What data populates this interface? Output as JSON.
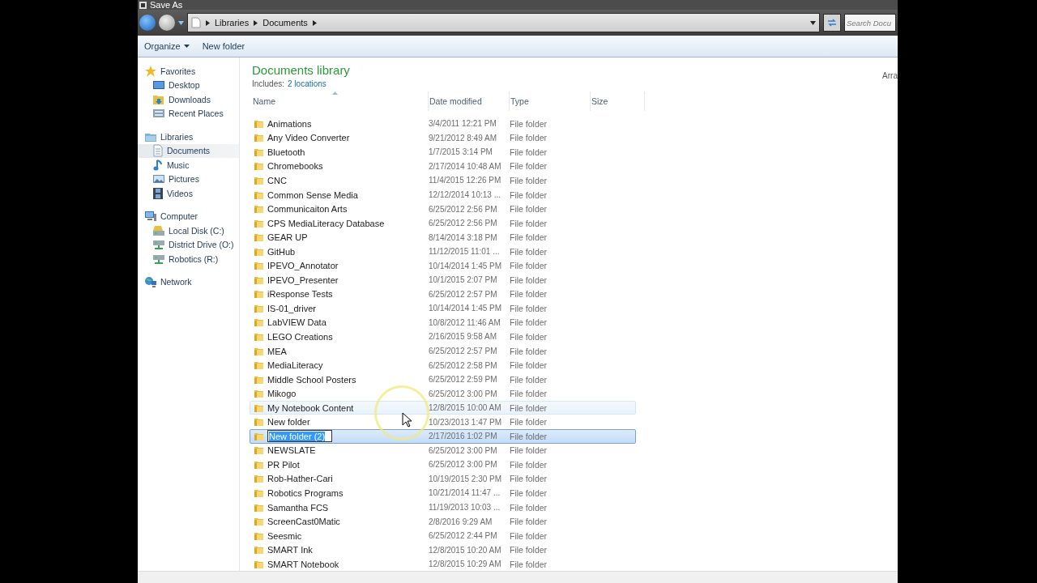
{
  "window": {
    "title": "Save As"
  },
  "address_bar": {
    "breadcrumbs": [
      "Libraries",
      "Documents"
    ]
  },
  "search": {
    "placeholder": "Search Docu"
  },
  "toolbar": {
    "buttons": [
      {
        "label": "Organize",
        "kind": "menu"
      },
      {
        "label": "New folder",
        "kind": "button"
      }
    ]
  },
  "navigation": {
    "sections": [
      {
        "label": "Favorites",
        "selected": false,
        "children": [
          {
            "label": "Desktop",
            "selected": false
          },
          {
            "label": "Downloads",
            "selected": false
          },
          {
            "label": "Recent Places",
            "selected": false
          }
        ]
      },
      {
        "label": "Libraries",
        "selected": false,
        "children": [
          {
            "label": "Documents",
            "selected": true
          },
          {
            "label": "Music",
            "selected": false
          },
          {
            "label": "Pictures",
            "selected": false
          },
          {
            "label": "Videos",
            "selected": false
          }
        ]
      },
      {
        "label": "Computer",
        "selected": false,
        "children": [
          {
            "label": "Local Disk (C:)",
            "selected": false
          },
          {
            "label": "District Drive (O:)",
            "selected": false
          },
          {
            "label": "Robotics (R:)",
            "selected": false
          }
        ]
      },
      {
        "label": "Network",
        "selected": false
      }
    ]
  },
  "library": {
    "title": "Documents library",
    "includes_label": "Includes:",
    "includes_link": "2 locations",
    "arrange_label": "Arra"
  },
  "file_list": {
    "columns": [
      {
        "label": "Name",
        "sorted": true
      },
      {
        "label": "Date modified",
        "sorted": false
      },
      {
        "label": "Type",
        "sorted": false
      },
      {
        "label": "Size",
        "sorted": false
      }
    ],
    "rows": [
      {
        "name": "Animations",
        "date": "3/4/2011 12:21 PM",
        "type": "File folder",
        "selected": false,
        "hovered": false,
        "editing": false
      },
      {
        "name": "Any Video Converter",
        "date": "9/21/2012 8:49 AM",
        "type": "File folder",
        "selected": false,
        "hovered": false,
        "editing": false
      },
      {
        "name": "Bluetooth",
        "date": "1/7/2015 3:14 PM",
        "type": "File folder",
        "selected": false,
        "hovered": false,
        "editing": false
      },
      {
        "name": "Chromebooks",
        "date": "2/17/2014 10:48 AM",
        "type": "File folder",
        "selected": false,
        "hovered": false,
        "editing": false
      },
      {
        "name": "CNC",
        "date": "11/4/2015 12:26 PM",
        "type": "File folder",
        "selected": false,
        "hovered": false,
        "editing": false
      },
      {
        "name": "Common Sense Media",
        "date": "12/12/2014 10:13 ...",
        "type": "File folder",
        "selected": false,
        "hovered": false,
        "editing": false
      },
      {
        "name": "Communicaiton Arts",
        "date": "6/25/2012 2:56 PM",
        "type": "File folder",
        "selected": false,
        "hovered": false,
        "editing": false
      },
      {
        "name": "CPS MediaLiteracy Database",
        "date": "6/25/2012 2:56 PM",
        "type": "File folder",
        "selected": false,
        "hovered": false,
        "editing": false
      },
      {
        "name": "GEAR UP",
        "date": "8/14/2014 3:18 PM",
        "type": "File folder",
        "selected": false,
        "hovered": false,
        "editing": false
      },
      {
        "name": "GitHub",
        "date": "11/12/2015 11:01 ...",
        "type": "File folder",
        "selected": false,
        "hovered": false,
        "editing": false
      },
      {
        "name": "IPEVO_Annotator",
        "date": "10/14/2014 1:45 PM",
        "type": "File folder",
        "selected": false,
        "hovered": false,
        "editing": false
      },
      {
        "name": "IPEVO_Presenter",
        "date": "10/1/2015 2:07 PM",
        "type": "File folder",
        "selected": false,
        "hovered": false,
        "editing": false
      },
      {
        "name": "iResponse Tests",
        "date": "6/25/2012 2:57 PM",
        "type": "File folder",
        "selected": false,
        "hovered": false,
        "editing": false
      },
      {
        "name": "IS-01_driver",
        "date": "10/14/2014 1:45 PM",
        "type": "File folder",
        "selected": false,
        "hovered": false,
        "editing": false
      },
      {
        "name": "LabVIEW Data",
        "date": "10/8/2012 11:46 AM",
        "type": "File folder",
        "selected": false,
        "hovered": false,
        "editing": false
      },
      {
        "name": "LEGO Creations",
        "date": "2/16/2015 9:58 AM",
        "type": "File folder",
        "selected": false,
        "hovered": false,
        "editing": false
      },
      {
        "name": "MEA",
        "date": "6/25/2012 2:57 PM",
        "type": "File folder",
        "selected": false,
        "hovered": false,
        "editing": false
      },
      {
        "name": "MediaLiteracy",
        "date": "6/25/2012 2:58 PM",
        "type": "File folder",
        "selected": false,
        "hovered": false,
        "editing": false
      },
      {
        "name": "Middle School Posters",
        "date": "6/25/2012 2:59 PM",
        "type": "File folder",
        "selected": false,
        "hovered": false,
        "editing": false
      },
      {
        "name": "Mikogo",
        "date": "6/25/2012 3:00 PM",
        "type": "File folder",
        "selected": false,
        "hovered": false,
        "editing": false
      },
      {
        "name": "My Notebook Content",
        "date": "12/8/2015 10:00 AM",
        "type": "File folder",
        "selected": false,
        "hovered": true,
        "editing": false
      },
      {
        "name": "New folder",
        "date": "10/23/2013 1:47 PM",
        "type": "File folder",
        "selected": false,
        "hovered": false,
        "editing": false
      },
      {
        "name": "New folder (2)",
        "date": "2/17/2016 1:02 PM",
        "type": "File folder",
        "selected": true,
        "hovered": false,
        "editing": true
      },
      {
        "name": "NEWSLATE",
        "date": "6/25/2012 3:00 PM",
        "type": "File folder",
        "selected": false,
        "hovered": false,
        "editing": false
      },
      {
        "name": "PR Pilot",
        "date": "6/25/2012 3:00 PM",
        "type": "File folder",
        "selected": false,
        "hovered": false,
        "editing": false
      },
      {
        "name": "Rob-Hather-Cari",
        "date": "10/19/2015 2:30 PM",
        "type": "File folder",
        "selected": false,
        "hovered": false,
        "editing": false
      },
      {
        "name": "Robotics Programs",
        "date": "10/21/2014 11:47 ...",
        "type": "File folder",
        "selected": false,
        "hovered": false,
        "editing": false
      },
      {
        "name": "Samantha FCS",
        "date": "11/19/2013 10:03 ...",
        "type": "File folder",
        "selected": false,
        "hovered": false,
        "editing": false
      },
      {
        "name": "ScreenCast0Matic",
        "date": "2/8/2016 9:29 AM",
        "type": "File folder",
        "selected": false,
        "hovered": false,
        "editing": false
      },
      {
        "name": "Seesmic",
        "date": "6/25/2012 2:44 PM",
        "type": "File folder",
        "selected": false,
        "hovered": false,
        "editing": false
      },
      {
        "name": "SMART Ink",
        "date": "12/8/2015 10:20 AM",
        "type": "File folder",
        "selected": false,
        "hovered": false,
        "editing": false
      },
      {
        "name": "SMART Notebook",
        "date": "12/8/2015 10:29 AM",
        "type": "File folder",
        "selected": false,
        "hovered": false,
        "editing": false
      }
    ]
  }
}
